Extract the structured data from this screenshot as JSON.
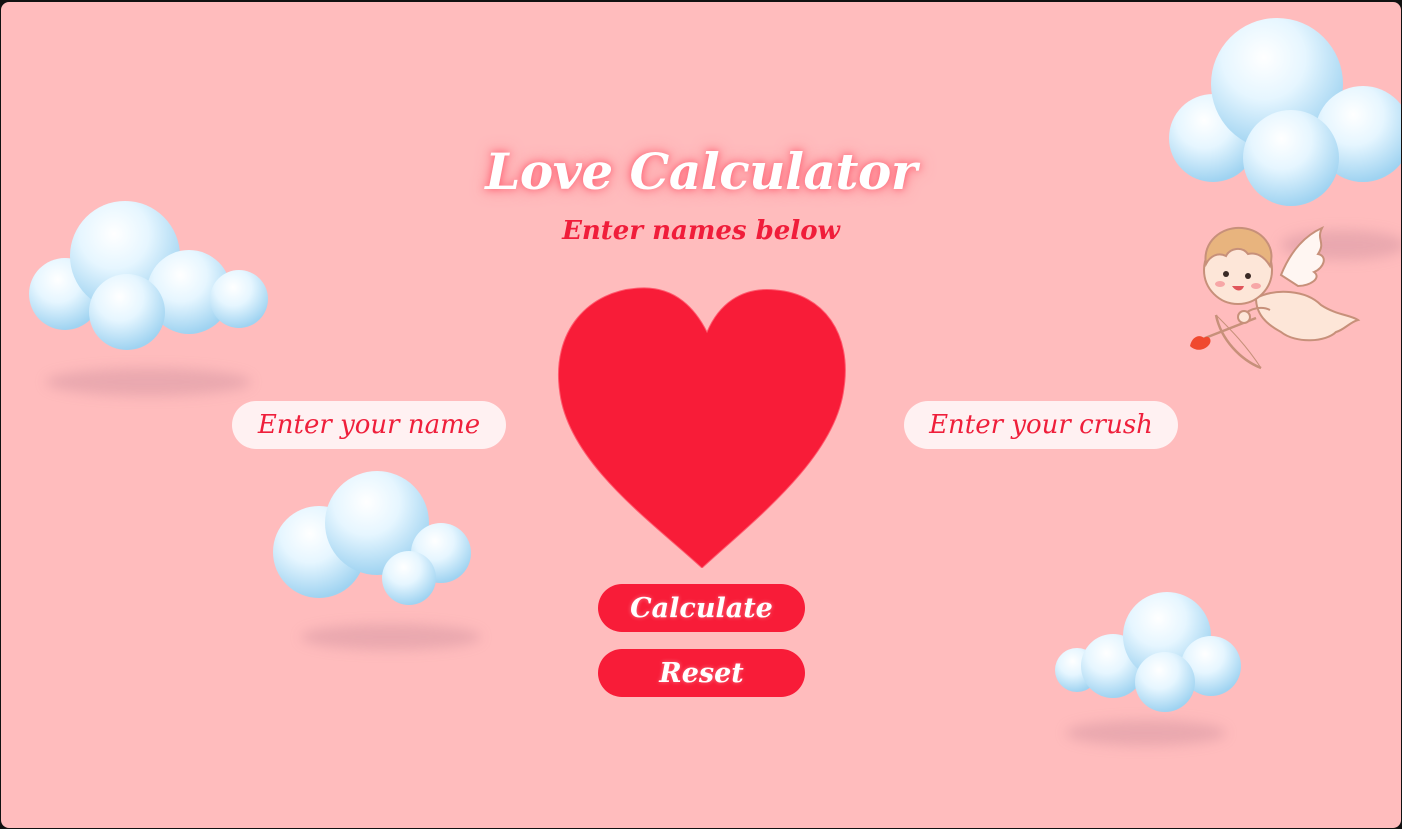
{
  "app": {
    "title": "Love Calculator",
    "subtitle": "Enter names below"
  },
  "inputs": {
    "name_placeholder": "Enter your name",
    "crush_placeholder": "Enter your crush"
  },
  "buttons": {
    "calculate_label": "Calculate",
    "reset_label": "Reset"
  },
  "colors": {
    "background": "#ffbcbd",
    "accent": "#f81c38",
    "heart": "#f81c38",
    "input_background": "#fff1f2"
  },
  "decorations": {
    "icons": [
      "heart-icon",
      "cloud-icon",
      "cupid-icon"
    ]
  }
}
